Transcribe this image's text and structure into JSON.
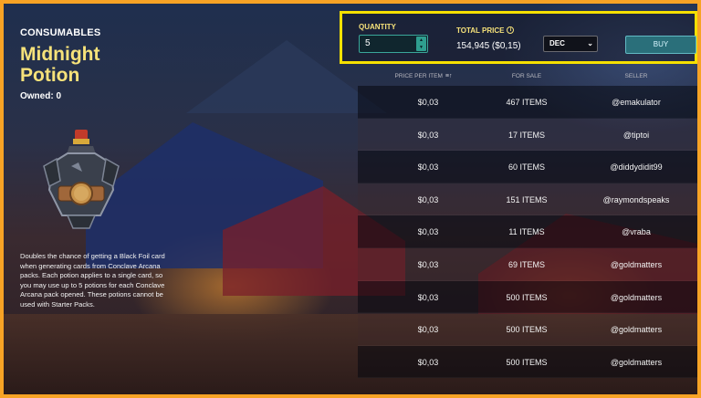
{
  "product": {
    "category": "CONSUMABLES",
    "title_line1": "Midnight",
    "title_line2": "Potion",
    "owned": "Owned: 0",
    "description": "Doubles the chance of getting a Black Foil card when generating cards from Conclave Arcana packs. Each potion applies to a single card, so you may use up to 5 potions for each Conclave Arcana pack opened. These potions cannot be used with Starter Packs.",
    "icon": "midnight-potion-icon"
  },
  "purchase": {
    "quantity_label": "QUANTITY",
    "quantity_value": "5",
    "total_label": "TOTAL PRICE",
    "total_value": "154,945 ($0,15)",
    "currency": "DEC",
    "buy_label": "BUY"
  },
  "table": {
    "headers": {
      "price": "PRICE PER ITEM",
      "for_sale": "FOR SALE",
      "seller": "SELLER"
    },
    "rows": [
      {
        "price": "$0,03",
        "for_sale": "467 ITEMS",
        "seller": "@emakulator"
      },
      {
        "price": "$0,03",
        "for_sale": "17 ITEMS",
        "seller": "@tiptoi"
      },
      {
        "price": "$0,03",
        "for_sale": "60 ITEMS",
        "seller": "@diddydidit99"
      },
      {
        "price": "$0,03",
        "for_sale": "151 ITEMS",
        "seller": "@raymondspeaks"
      },
      {
        "price": "$0,03",
        "for_sale": "11 ITEMS",
        "seller": "@vraba"
      },
      {
        "price": "$0,03",
        "for_sale": "69 ITEMS",
        "seller": "@goldmatters"
      },
      {
        "price": "$0,03",
        "for_sale": "500 ITEMS",
        "seller": "@goldmatters"
      },
      {
        "price": "$0,03",
        "for_sale": "500 ITEMS",
        "seller": "@goldmatters"
      },
      {
        "price": "$0,03",
        "for_sale": "500 ITEMS",
        "seller": "@goldmatters"
      }
    ]
  },
  "colors": {
    "frame": "#f7a325",
    "highlight": "#f5e000",
    "title": "#f6e27a",
    "button": "#2a6f7a"
  }
}
